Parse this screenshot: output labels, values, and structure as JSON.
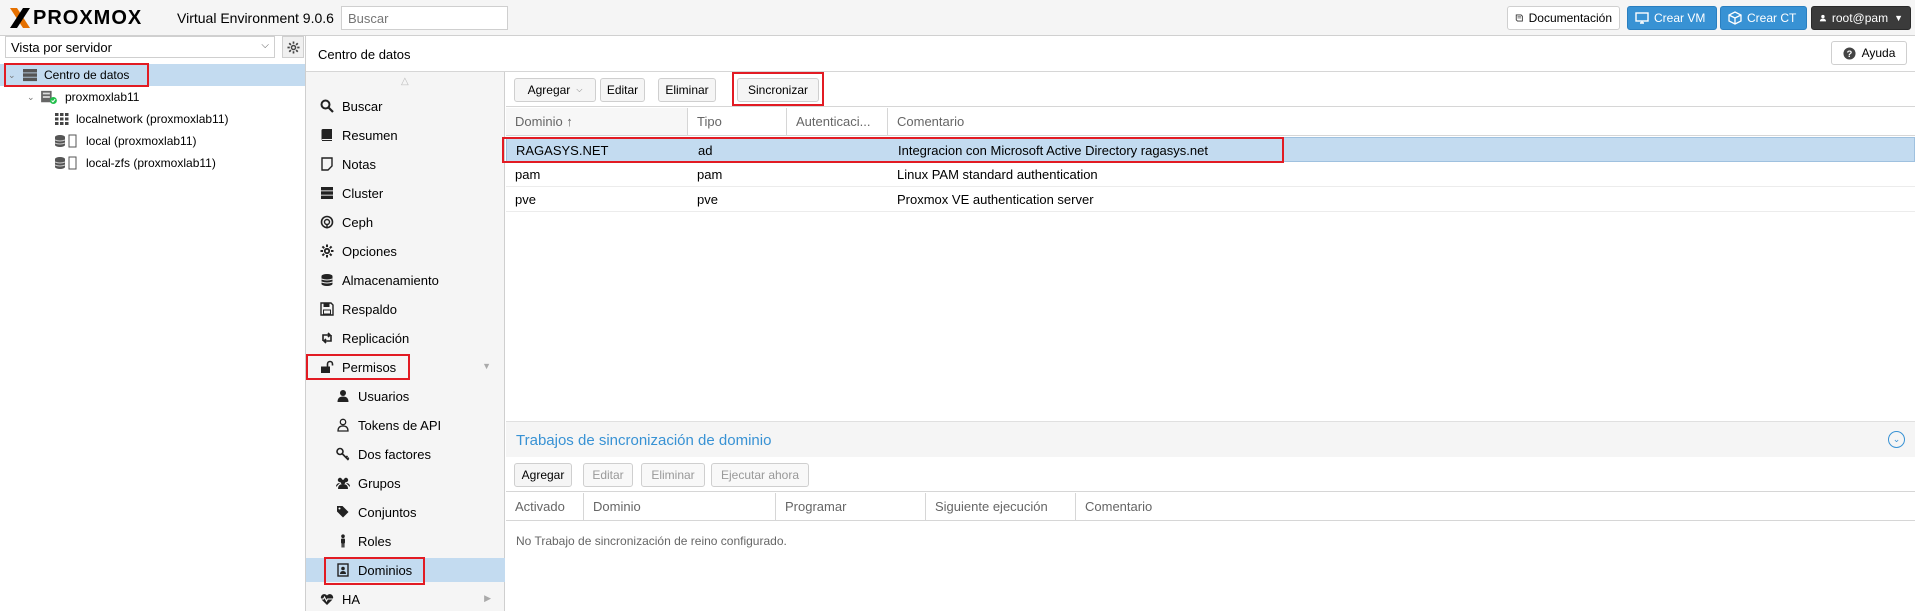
{
  "header": {
    "brand": "PROXMOX",
    "version": "Virtual Environment 9.0.6",
    "search_placeholder": "Buscar",
    "doc_label": "Documentación",
    "create_vm_label": "Crear VM",
    "create_ct_label": "Crear CT",
    "user_label": "root@pam",
    "brand_color": "#e57000",
    "accent_color": "#3892d4"
  },
  "tree": {
    "view_label": "Vista por servidor",
    "items": [
      {
        "label": "Centro de datos",
        "icon": "datacenter-icon"
      },
      {
        "label": "proxmoxlab11",
        "icon": "node-icon"
      },
      {
        "label": "localnetwork (proxmoxlab11)",
        "icon": "network-grid-icon"
      },
      {
        "label": "local (proxmoxlab11)",
        "icon": "storage-icon"
      },
      {
        "label": "local-zfs (proxmoxlab11)",
        "icon": "storage-icon"
      }
    ]
  },
  "content_header": {
    "title": "Centro de datos",
    "help_label": "Ayuda"
  },
  "nav": {
    "items": [
      {
        "label": "Buscar",
        "icon": "search-icon"
      },
      {
        "label": "Resumen",
        "icon": "book-icon"
      },
      {
        "label": "Notas",
        "icon": "notes-icon"
      },
      {
        "label": "Cluster",
        "icon": "server-icon"
      },
      {
        "label": "Ceph",
        "icon": "ceph-icon"
      },
      {
        "label": "Opciones",
        "icon": "gear-icon"
      },
      {
        "label": "Almacenamiento",
        "icon": "database-icon"
      },
      {
        "label": "Respaldo",
        "icon": "floppy-icon"
      },
      {
        "label": "Replicación",
        "icon": "retweet-icon"
      },
      {
        "label": "Permisos",
        "icon": "unlock-icon"
      },
      {
        "label": "Usuarios",
        "icon": "user-icon"
      },
      {
        "label": "Tokens de API",
        "icon": "user-outline-icon"
      },
      {
        "label": "Dos factores",
        "icon": "key-icon"
      },
      {
        "label": "Grupos",
        "icon": "users-icon"
      },
      {
        "label": "Conjuntos",
        "icon": "tags-icon"
      },
      {
        "label": "Roles",
        "icon": "male-icon"
      },
      {
        "label": "Dominios",
        "icon": "address-book-icon"
      },
      {
        "label": "HA",
        "icon": "heartbeat-icon"
      }
    ]
  },
  "realms": {
    "toolbar": {
      "add_label": "Agregar",
      "edit_label": "Editar",
      "delete_label": "Eliminar",
      "sync_label": "Sincronizar"
    },
    "columns": [
      "Dominio ↑",
      "Tipo",
      "Autenticaci...",
      "Comentario"
    ],
    "rows": [
      {
        "realm": "RAGASYS.NET",
        "type": "ad",
        "tfa": "",
        "comment": "Integracion con Microsoft Active Directory ragasys.net"
      },
      {
        "realm": "pam",
        "type": "pam",
        "tfa": "",
        "comment": "Linux PAM standard authentication"
      },
      {
        "realm": "pve",
        "type": "pve",
        "tfa": "",
        "comment": "Proxmox VE authentication server"
      }
    ]
  },
  "sync_jobs": {
    "title": "Trabajos de sincronización de dominio",
    "toolbar": {
      "add_label": "Agregar",
      "edit_label": "Editar",
      "delete_label": "Eliminar",
      "run_label": "Ejecutar ahora"
    },
    "columns": [
      "Activado",
      "Dominio",
      "Programar",
      "Siguiente ejecución",
      "Comentario"
    ],
    "empty_text": "No Trabajo de sincronización de reino configurado."
  }
}
